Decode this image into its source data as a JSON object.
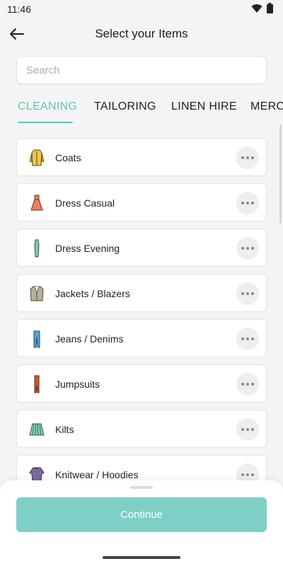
{
  "status": {
    "time": "11:46"
  },
  "header": {
    "title": "Select your Items"
  },
  "search": {
    "placeholder": "Search"
  },
  "tabs": [
    "CLEANING",
    "TAILORING",
    "LINEN HIRE",
    "MERCH"
  ],
  "active_tab": "CLEANING",
  "colors": {
    "accent": "#64c3b8",
    "button": "#7ecfc6"
  },
  "items": [
    {
      "label": "Coats",
      "icon": "coat-icon"
    },
    {
      "label": "Dress Casual",
      "icon": "dress-casual-icon"
    },
    {
      "label": "Dress Evening",
      "icon": "dress-evening-icon"
    },
    {
      "label": "Jackets / Blazers",
      "icon": "blazer-icon"
    },
    {
      "label": "Jeans / Denims",
      "icon": "jeans-icon"
    },
    {
      "label": "Jumpsuits",
      "icon": "jumpsuit-icon"
    },
    {
      "label": "Kilts",
      "icon": "kilt-icon"
    },
    {
      "label": "Knitwear / Hoodies",
      "icon": "knitwear-icon"
    }
  ],
  "footer": {
    "continue_label": "Continue"
  }
}
